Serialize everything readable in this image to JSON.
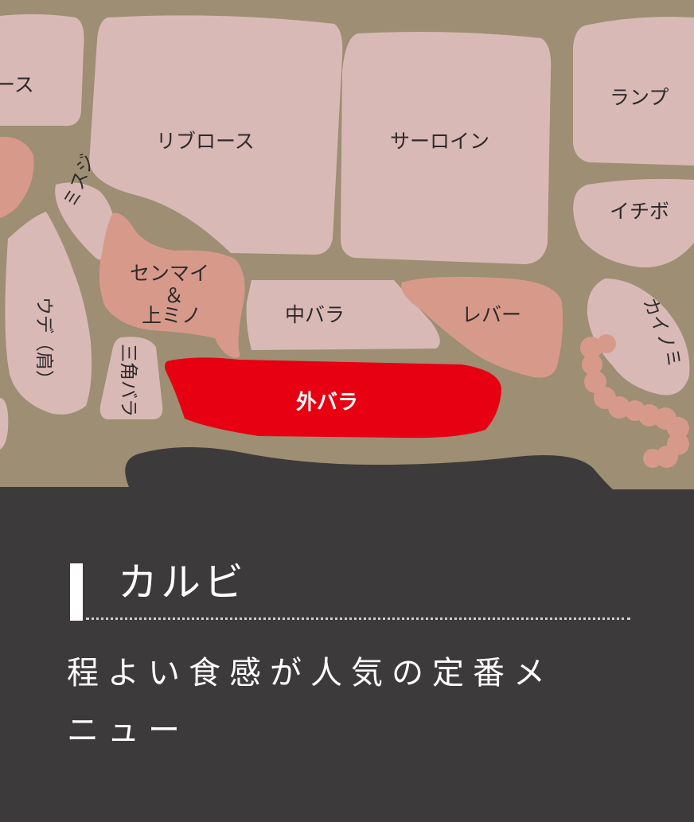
{
  "map": {
    "background_color": "#9d8e74",
    "part_color": "#d9b9b5",
    "organ_color": "#d79a8a",
    "highlight_color": "#e60012",
    "parts": {
      "roast_partial": "ース",
      "ribroast": "リブロース",
      "sirloin": "サーロイン",
      "rump": "ランプ",
      "ichibo": "イチボ",
      "misuji": "ミスジ",
      "senmai_line1": "センマイ",
      "senmai_line2": "＆",
      "senmai_line3": "上ミノ",
      "nakabara": "中バラ",
      "liver": "レバー",
      "kainomi": "カイノミ",
      "ude": "ウデ（肩）",
      "sankaku_bara": "三角バラ",
      "sotobara": "外バラ"
    }
  },
  "info": {
    "title": "カルビ",
    "description_line1": "程よい食感が人気の定番メ",
    "description_line2": "ニュー"
  }
}
